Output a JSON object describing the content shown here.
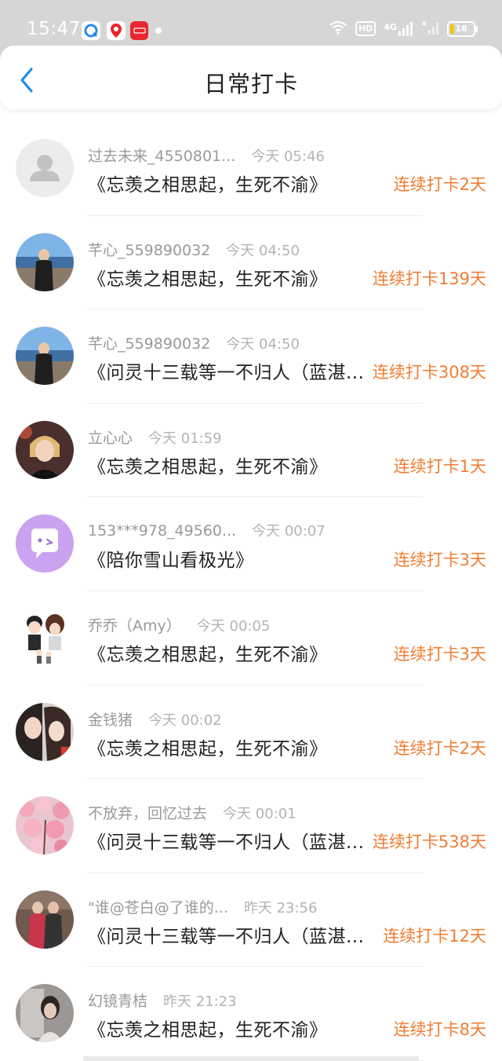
{
  "status_bar": {
    "time": "15:47",
    "network": "4G",
    "hd": "HD",
    "battery": "18"
  },
  "header": {
    "title": "日常打卡"
  },
  "colors": {
    "accent": "#1e8fe6",
    "streak": "#f07d32"
  },
  "records": [
    {
      "name": "过去未来_4550801...",
      "time": "今天 05:46",
      "book": "《忘羡之相思起，生死不渝》",
      "streak": "连续打卡2天",
      "avatar": "default-user-icon"
    },
    {
      "name": "芊心_559890032",
      "time": "今天 04:50",
      "book": "《忘羡之相思起，生死不渝》",
      "streak": "连续打卡139天",
      "avatar": "photo-person-seaside"
    },
    {
      "name": "芊心_559890032",
      "time": "今天 04:50",
      "book": "《问灵十三载等一不归人（蓝湛...",
      "streak": "连续打卡308天",
      "avatar": "photo-person-seaside"
    },
    {
      "name": "立心心",
      "time": "今天 01:59",
      "book": "《忘羡之相思起，生死不渝》",
      "streak": "连续打卡1天",
      "avatar": "photo-woman-portrait"
    },
    {
      "name": "153***978_49560...",
      "time": "今天 00:07",
      "book": "《陪你雪山看极光》",
      "streak": "连续打卡3天",
      "avatar": "chat-bubble-icon"
    },
    {
      "name": "乔乔（Amy）",
      "time": "今天 00:05",
      "book": "《忘羡之相思起，生死不渝》",
      "streak": "连续打卡3天",
      "avatar": "cartoon-couple"
    },
    {
      "name": "金钱猪",
      "time": "今天 00:02",
      "book": "《忘羡之相思起，生死不渝》",
      "streak": "连续打卡2天",
      "avatar": "photo-two-women"
    },
    {
      "name": "不放弃，回忆过去",
      "time": "今天 00:01",
      "book": "《问灵十三载等一不归人（蓝湛...",
      "streak": "连续打卡538天",
      "avatar": "photo-pink-blossoms"
    },
    {
      "name": "\"谁@苍白@了谁的...",
      "time": "昨天 23:56",
      "book": "《问灵十三载等一不归人（蓝湛...",
      "streak": "连续打卡12天",
      "avatar": "photo-mother-child"
    },
    {
      "name": "幻镜青桔",
      "time": "昨天 21:23",
      "book": "《忘羡之相思起，生死不渝》",
      "streak": "连续打卡8天",
      "avatar": "photo-mirror-selfie"
    }
  ]
}
